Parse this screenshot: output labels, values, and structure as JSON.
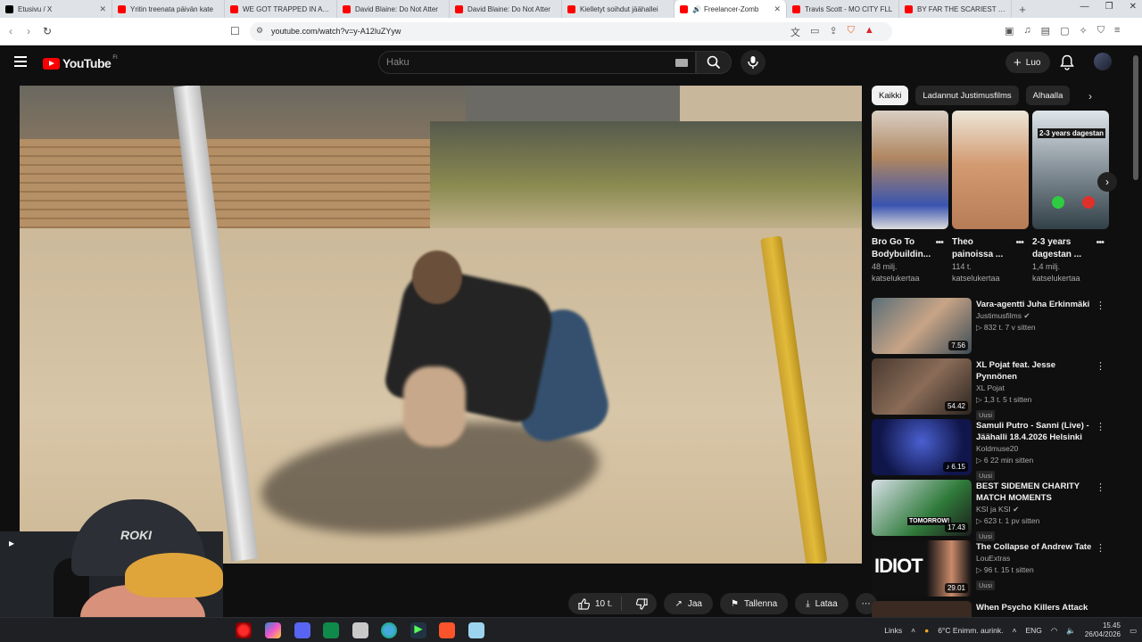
{
  "browser": {
    "tabs": [
      {
        "label": "Etusivu / X",
        "icon": "x-icon",
        "active": false
      },
      {
        "label": "Yritin treenata päivän kate",
        "icon": "youtube-icon",
        "active": false
      },
      {
        "label": "WE GOT TRAPPED IN A BO",
        "icon": "youtube-icon",
        "active": false
      },
      {
        "label": "David Blaine: Do Not Atter",
        "icon": "youtube-icon",
        "active": false
      },
      {
        "label": "David Blaine: Do Not Atter",
        "icon": "youtube-icon",
        "active": false
      },
      {
        "label": "Kielletyt soihdut jäähallei",
        "icon": "youtube-icon",
        "active": false
      },
      {
        "label": "Freelancer-Zomb",
        "icon": "youtube-icon",
        "active": true
      },
      {
        "label": "Travis Scott - MO CITY FLL",
        "icon": "youtube-icon",
        "active": false
      },
      {
        "label": "BY FAR THE SCARIEST GAI",
        "icon": "youtube-icon",
        "active": false
      }
    ],
    "new_tab": "+",
    "url": "youtube.com/watch?v=y-A12luZYyw"
  },
  "header": {
    "logo_text": "YouTube",
    "region": "FI",
    "search_placeholder": "Haku",
    "create_label": "Luo"
  },
  "video": {
    "webcam_cap_text": "ROKI"
  },
  "actions": {
    "likes": "10 t.",
    "share": "Jaa",
    "save": "Tallenna",
    "download": "Lataa"
  },
  "chips": [
    {
      "label": "Kaikki",
      "active": true
    },
    {
      "label": "Ladannut Justimusfilms",
      "active": false
    },
    {
      "label": "Alhaalla",
      "active": false
    }
  ],
  "shorts": [
    {
      "title": "Bro Go To",
      "title2": "Bodybuildin...",
      "views": "48 milj.",
      "views2": "katselukertaa",
      "thumb_text": ""
    },
    {
      "title": "Theo",
      "title2": "painoissa ...",
      "views": "114 t.",
      "views2": "katselukertaa",
      "thumb_text": ""
    },
    {
      "title": "2-3 years",
      "title2": "dagestan ...",
      "views": "1,4 milj.",
      "views2": "katselukertaa",
      "thumb_text": "2-3 years dagestan"
    }
  ],
  "recommendations": [
    {
      "title": "Vara-agentti Juha Erkinmäki",
      "channel": "Justimusfilms",
      "verified": true,
      "meta": "832 t.   7 v sitten",
      "duration": "7.56",
      "badge": ""
    },
    {
      "title": "XL Pojat feat. Jesse Pynnönen",
      "channel": "XL Pojat",
      "verified": false,
      "meta": "1,3 t.   5 t sitten",
      "duration": "54.42",
      "badge": "Uusi"
    },
    {
      "title": "Samuli Putro - Sanni (Live) - Jäähalli 18.4.2026 Helsinki",
      "channel": "Koldmuse20",
      "verified": false,
      "meta": "6   22 min sitten",
      "duration": "6.15",
      "badge": "Uusi"
    },
    {
      "title": "BEST SIDEMEN CHARITY MATCH MOMENTS",
      "channel": "KSI ja KSI",
      "verified": true,
      "meta": "623 t.   1 pv sitten",
      "duration": "17.43",
      "badge": "Uusi",
      "thumb_text": "TOMORROW!"
    },
    {
      "title": "The Collapse of Andrew Tate",
      "channel": "LouExtras",
      "verified": false,
      "meta": "96 t.   15 t sitten",
      "duration": "29.01",
      "badge": "Uusi",
      "thumb_text": "IDIOT"
    },
    {
      "title": "When Psycho Killers Attack",
      "channel": "",
      "verified": false,
      "meta": "",
      "duration": "",
      "badge": ""
    }
  ],
  "taskbar": {
    "links_label": "Links",
    "weather": "6°C  Enimm. aurink.",
    "lang": "ENG",
    "time": "15.45",
    "date": "26/04/2026"
  },
  "colors": {
    "youtube_red": "#ff0000",
    "background": "#0f0f0f",
    "chip_active": "#f1f1f1"
  }
}
